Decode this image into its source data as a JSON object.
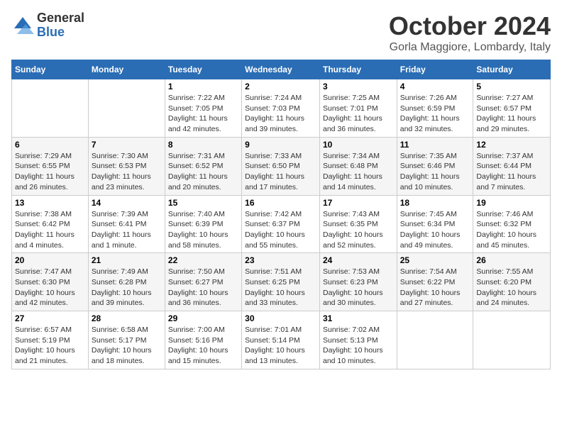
{
  "logo": {
    "general": "General",
    "blue": "Blue"
  },
  "title": "October 2024",
  "location": "Gorla Maggiore, Lombardy, Italy",
  "days_of_week": [
    "Sunday",
    "Monday",
    "Tuesday",
    "Wednesday",
    "Thursday",
    "Friday",
    "Saturday"
  ],
  "weeks": [
    [
      {
        "day": "",
        "info": ""
      },
      {
        "day": "",
        "info": ""
      },
      {
        "day": "1",
        "info": "Sunrise: 7:22 AM\nSunset: 7:05 PM\nDaylight: 11 hours and 42 minutes."
      },
      {
        "day": "2",
        "info": "Sunrise: 7:24 AM\nSunset: 7:03 PM\nDaylight: 11 hours and 39 minutes."
      },
      {
        "day": "3",
        "info": "Sunrise: 7:25 AM\nSunset: 7:01 PM\nDaylight: 11 hours and 36 minutes."
      },
      {
        "day": "4",
        "info": "Sunrise: 7:26 AM\nSunset: 6:59 PM\nDaylight: 11 hours and 32 minutes."
      },
      {
        "day": "5",
        "info": "Sunrise: 7:27 AM\nSunset: 6:57 PM\nDaylight: 11 hours and 29 minutes."
      }
    ],
    [
      {
        "day": "6",
        "info": "Sunrise: 7:29 AM\nSunset: 6:55 PM\nDaylight: 11 hours and 26 minutes."
      },
      {
        "day": "7",
        "info": "Sunrise: 7:30 AM\nSunset: 6:53 PM\nDaylight: 11 hours and 23 minutes."
      },
      {
        "day": "8",
        "info": "Sunrise: 7:31 AM\nSunset: 6:52 PM\nDaylight: 11 hours and 20 minutes."
      },
      {
        "day": "9",
        "info": "Sunrise: 7:33 AM\nSunset: 6:50 PM\nDaylight: 11 hours and 17 minutes."
      },
      {
        "day": "10",
        "info": "Sunrise: 7:34 AM\nSunset: 6:48 PM\nDaylight: 11 hours and 14 minutes."
      },
      {
        "day": "11",
        "info": "Sunrise: 7:35 AM\nSunset: 6:46 PM\nDaylight: 11 hours and 10 minutes."
      },
      {
        "day": "12",
        "info": "Sunrise: 7:37 AM\nSunset: 6:44 PM\nDaylight: 11 hours and 7 minutes."
      }
    ],
    [
      {
        "day": "13",
        "info": "Sunrise: 7:38 AM\nSunset: 6:42 PM\nDaylight: 11 hours and 4 minutes."
      },
      {
        "day": "14",
        "info": "Sunrise: 7:39 AM\nSunset: 6:41 PM\nDaylight: 11 hours and 1 minute."
      },
      {
        "day": "15",
        "info": "Sunrise: 7:40 AM\nSunset: 6:39 PM\nDaylight: 10 hours and 58 minutes."
      },
      {
        "day": "16",
        "info": "Sunrise: 7:42 AM\nSunset: 6:37 PM\nDaylight: 10 hours and 55 minutes."
      },
      {
        "day": "17",
        "info": "Sunrise: 7:43 AM\nSunset: 6:35 PM\nDaylight: 10 hours and 52 minutes."
      },
      {
        "day": "18",
        "info": "Sunrise: 7:45 AM\nSunset: 6:34 PM\nDaylight: 10 hours and 49 minutes."
      },
      {
        "day": "19",
        "info": "Sunrise: 7:46 AM\nSunset: 6:32 PM\nDaylight: 10 hours and 45 minutes."
      }
    ],
    [
      {
        "day": "20",
        "info": "Sunrise: 7:47 AM\nSunset: 6:30 PM\nDaylight: 10 hours and 42 minutes."
      },
      {
        "day": "21",
        "info": "Sunrise: 7:49 AM\nSunset: 6:28 PM\nDaylight: 10 hours and 39 minutes."
      },
      {
        "day": "22",
        "info": "Sunrise: 7:50 AM\nSunset: 6:27 PM\nDaylight: 10 hours and 36 minutes."
      },
      {
        "day": "23",
        "info": "Sunrise: 7:51 AM\nSunset: 6:25 PM\nDaylight: 10 hours and 33 minutes."
      },
      {
        "day": "24",
        "info": "Sunrise: 7:53 AM\nSunset: 6:23 PM\nDaylight: 10 hours and 30 minutes."
      },
      {
        "day": "25",
        "info": "Sunrise: 7:54 AM\nSunset: 6:22 PM\nDaylight: 10 hours and 27 minutes."
      },
      {
        "day": "26",
        "info": "Sunrise: 7:55 AM\nSunset: 6:20 PM\nDaylight: 10 hours and 24 minutes."
      }
    ],
    [
      {
        "day": "27",
        "info": "Sunrise: 6:57 AM\nSunset: 5:19 PM\nDaylight: 10 hours and 21 minutes."
      },
      {
        "day": "28",
        "info": "Sunrise: 6:58 AM\nSunset: 5:17 PM\nDaylight: 10 hours and 18 minutes."
      },
      {
        "day": "29",
        "info": "Sunrise: 7:00 AM\nSunset: 5:16 PM\nDaylight: 10 hours and 15 minutes."
      },
      {
        "day": "30",
        "info": "Sunrise: 7:01 AM\nSunset: 5:14 PM\nDaylight: 10 hours and 13 minutes."
      },
      {
        "day": "31",
        "info": "Sunrise: 7:02 AM\nSunset: 5:13 PM\nDaylight: 10 hours and 10 minutes."
      },
      {
        "day": "",
        "info": ""
      },
      {
        "day": "",
        "info": ""
      }
    ]
  ]
}
